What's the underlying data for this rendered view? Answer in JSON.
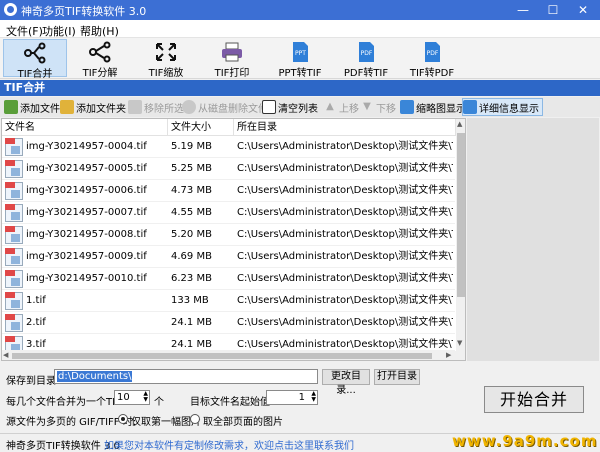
{
  "window": {
    "title": "神奇多页TIF转换软件 3.0"
  },
  "menu": [
    "文件(F)",
    "功能(I)",
    "帮助(H)"
  ],
  "toolbar": {
    "tools": [
      {
        "label": "TIF合并",
        "icon": "merge-icon"
      },
      {
        "label": "TIF分解",
        "icon": "split-icon"
      },
      {
        "label": "TIF缩放",
        "icon": "resize-icon"
      },
      {
        "label": "TIF打印",
        "icon": "print-icon"
      },
      {
        "label": "PPT转TIF",
        "icon": "ppt-file-icon",
        "badge": "PPT"
      },
      {
        "label": "PDF转TIF",
        "icon": "pdf-file-icon",
        "badge": "PDF"
      },
      {
        "label": "TIF转PDF",
        "icon": "pdf-file-icon",
        "badge": "PDF"
      }
    ]
  },
  "section": {
    "title": "TIF合并"
  },
  "actions": {
    "add_file": "添加文件",
    "add_folder": "添加文件夹",
    "remove_selected": "移除所选",
    "delete_from_disk": "从磁盘删除文件",
    "clear_list": "清空列表",
    "move_up": "上移",
    "move_down": "下移",
    "thumbnail_view": "缩略图显示",
    "detail_view": "详细信息显示"
  },
  "table": {
    "headers": [
      "文件名",
      "文件大小",
      "所在目录"
    ],
    "rows": [
      [
        "img-Y30214957-0004.tif",
        "5.19 MB",
        "C:\\Users\\Administrator\\Desktop\\测试文件夹\\TIF\\"
      ],
      [
        "img-Y30214957-0005.tif",
        "5.25 MB",
        "C:\\Users\\Administrator\\Desktop\\测试文件夹\\TIF\\"
      ],
      [
        "img-Y30214957-0006.tif",
        "4.73 MB",
        "C:\\Users\\Administrator\\Desktop\\测试文件夹\\TIF\\"
      ],
      [
        "img-Y30214957-0007.tif",
        "4.55 MB",
        "C:\\Users\\Administrator\\Desktop\\测试文件夹\\TIF\\"
      ],
      [
        "img-Y30214957-0008.tif",
        "5.20 MB",
        "C:\\Users\\Administrator\\Desktop\\测试文件夹\\TIF\\"
      ],
      [
        "img-Y30214957-0009.tif",
        "4.69 MB",
        "C:\\Users\\Administrator\\Desktop\\测试文件夹\\TIF\\"
      ],
      [
        "img-Y30214957-0010.tif",
        "6.23 MB",
        "C:\\Users\\Administrator\\Desktop\\测试文件夹\\TIF\\"
      ],
      [
        "1.tif",
        "133 MB",
        "C:\\Users\\Administrator\\Desktop\\测试文件夹\\TIF\\"
      ],
      [
        "2.tif",
        "24.1 MB",
        "C:\\Users\\Administrator\\Desktop\\测试文件夹\\TIF\\"
      ],
      [
        "3.tif",
        "24.1 MB",
        "C:\\Users\\Administrator\\Desktop\\测试文件夹\\TIF\\"
      ]
    ]
  },
  "options": {
    "save_dir_label": "保存到目录:",
    "save_dir_value": "d:\\Documents\\",
    "change_dir_button": "更改目录...",
    "open_dir_button": "打开目录",
    "files_per_tiff_label": "每几个文件合并为一个TIFF:",
    "files_per_tiff_value": "10",
    "files_per_tiff_unit": "个",
    "start_number_label": "目标文件名起始值:",
    "start_number_value": "1",
    "gif_label": "源文件为多页的 GIF/TIFF 时:",
    "radio_first_page": "仅取第一幅图片",
    "radio_all_pages": "取全部页面的图片",
    "start_button": "开始合并"
  },
  "status": {
    "app_name": "神奇多页TIF转换软件 3.0",
    "message": "如果您对本软件有定制修改需求，欢迎点击这里联系我们"
  },
  "watermark": "www.9a9m.com"
}
